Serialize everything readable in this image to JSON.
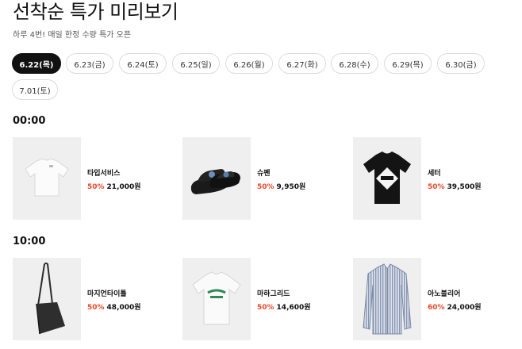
{
  "header": {
    "title": "선착순 특가 미리보기",
    "subtitle": "하루 4번! 매일 한정 수량 특가 오픈"
  },
  "dates": [
    {
      "label": "6.22(목)",
      "active": true
    },
    {
      "label": "6.23(금)",
      "active": false
    },
    {
      "label": "6.24(토)",
      "active": false
    },
    {
      "label": "6.25(일)",
      "active": false
    },
    {
      "label": "6.26(월)",
      "active": false
    },
    {
      "label": "6.27(화)",
      "active": false
    },
    {
      "label": "6.28(수)",
      "active": false
    },
    {
      "label": "6.29(목)",
      "active": false
    },
    {
      "label": "6.30(금)",
      "active": false
    },
    {
      "label": "7.01(토)",
      "active": false
    }
  ],
  "slots": [
    {
      "time": "00:00",
      "items": [
        {
          "brand": "타입서비스",
          "discount": "50%",
          "price": "21,000원",
          "image": "white-tshirt-icon"
        },
        {
          "brand": "슈펜",
          "discount": "50%",
          "price": "9,950원",
          "image": "slide-sandal-icon"
        },
        {
          "brand": "세터",
          "discount": "50%",
          "price": "39,500원",
          "image": "black-graphic-tshirt-icon"
        }
      ]
    },
    {
      "time": "10:00",
      "items": [
        {
          "brand": "마지언타이틀",
          "discount": "50%",
          "price": "48,000원",
          "image": "crossbody-bag-icon"
        },
        {
          "brand": "마하그리드",
          "discount": "50%",
          "price": "14,600원",
          "image": "logo-tshirt-icon"
        },
        {
          "brand": "아노블리어",
          "discount": "60%",
          "price": "24,000원",
          "image": "striped-shirt-icon"
        }
      ]
    }
  ],
  "colors": {
    "accent": "#e8482a",
    "active_chip": "#111111",
    "thumb_bg": "#efefef"
  }
}
